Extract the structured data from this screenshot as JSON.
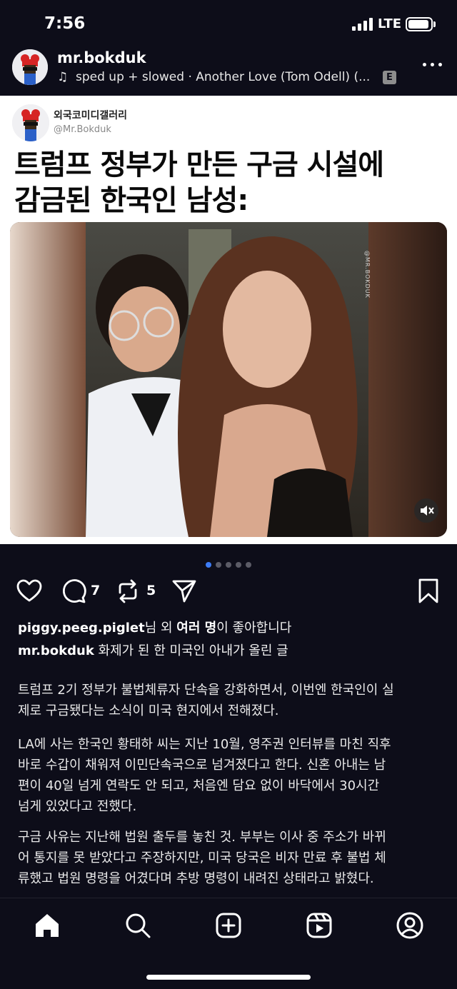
{
  "status_bar": {
    "time": "7:56",
    "network": "LTE"
  },
  "post": {
    "username": "mr.bokduk",
    "audio": "sped up + slowed · Another Love (Tom Odell) (...",
    "explicit_badge": "E"
  },
  "embed": {
    "account_name": "외국코미디갤러리",
    "handle": "@Mr.Bokduk",
    "headline_line1": "트럼프 정부가 만든 구금 시설에",
    "headline_line2": "감금된 한국인 남성:",
    "watermark": "@MR.BOKDUK"
  },
  "carousel": {
    "total": 5,
    "active_index": 0
  },
  "actions": {
    "comments": "7",
    "reposts": "5"
  },
  "likes": {
    "user": "piggy.peeg.piglet",
    "text_a": "님 외 ",
    "bold_b": "여러 명",
    "text_c": "이 좋아합니다"
  },
  "caption": {
    "username": "mr.bokduk",
    "text": " 화제가 된 한 미국인 아내가 올린 글",
    "para1_l1": "트럼프 2기 정부가 불법체류자 단속을 강화하면서, 이번엔 한국인이 실",
    "para1_l2": "제로 구금됐다는 소식이 미국 현지에서 전해졌다.",
    "para2_l1": "LA에 사는 한국인 황태하 씨는 지난 10월, 영주권 인터뷰를 마친 직후",
    "para2_l2": "바로 수갑이 채워져 이민단속국으로 넘겨졌다고 한다. 신혼 아내는 남",
    "para2_l3": "편이 40일 넘게 연락도 안 되고, 처음엔 담요 없이 바닥에서 30시간",
    "para2_l4": "넘게 있었다고 전했다.",
    "para3_l1": "구금 사유는 지난해 법원 출두를 놓친 것. 부부는 이사 중 주소가 바뀌",
    "para3_l2": "어 통지를 못 받았다고 주장하지만, 미국 당국은 비자 만료 후 불법 체",
    "para3_l3": "류했고 법원 명령을 어겼다며 추방 명령이 내려진 상태라고 밝혔다."
  },
  "icons": {
    "status": [
      "signal-icon",
      "battery-icon"
    ],
    "header": [
      "music-note-icon",
      "more-icon"
    ],
    "actions": [
      "heart-icon",
      "comment-icon",
      "repost-icon",
      "send-icon",
      "bookmark-icon"
    ],
    "tabs": [
      "home-icon",
      "search-icon",
      "create-icon",
      "reels-icon",
      "profile-icon"
    ],
    "media": [
      "mute-icon"
    ]
  },
  "colors": {
    "background": "#0d0d19",
    "active_dot": "#3d7cf5",
    "text": "#f2f2f2"
  }
}
